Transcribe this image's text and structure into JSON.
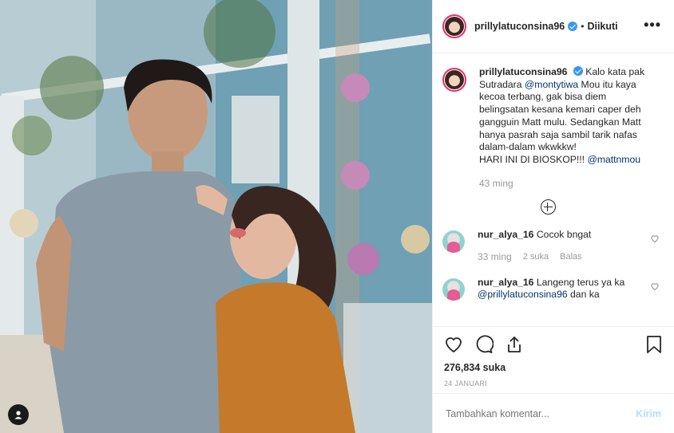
{
  "post": {
    "username": "prillylatuconsina96",
    "follow_status": "Diikuti",
    "more_label": "•••"
  },
  "caption": {
    "username": "prillylatuconsina96",
    "text_1": "Kalo kata pak Sutradara ",
    "mention_1": "@montytiwa",
    "text_2": " Mou itu kaya kecoa terbang, gak bisa diem belingsatan kesana kemari caper deh gangguin Matt mulu. Sedangkan Matt hanya pasrah saja sambil tarik nafas dalam-dalam wkwkkw!",
    "text_3": "HARI INI DI BIOSKOP!!! ",
    "mention_2": "@mattnmou",
    "time": "43 ming"
  },
  "comments": [
    {
      "username": "nur_alya_16",
      "text": "Cocok bngat",
      "time": "33 ming",
      "likes": "2 suka",
      "reply": "Balas"
    },
    {
      "username": "nur_alya_16",
      "text_1": "Langeng terus ya ka ",
      "mention": "@prillylatuconsina96",
      "text_2": " dan ka"
    }
  ],
  "likes": "276,834 suka",
  "date": "24 JANUARI",
  "add_comment": {
    "placeholder": "Tambahkan komentar...",
    "post_label": "Kirim"
  },
  "icons": [
    "heart-icon",
    "comment-icon",
    "share-icon",
    "bookmark-icon",
    "load-more-icon",
    "user-tag-icon",
    "verified-icon"
  ],
  "colors": {
    "verified": "#3897f0",
    "mention": "#003569",
    "post_disabled": "#b2dffc",
    "muted": "#999999"
  }
}
